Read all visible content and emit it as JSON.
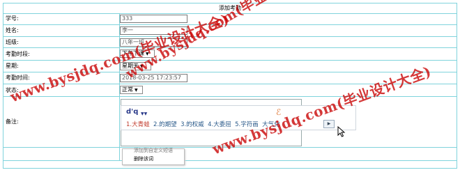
{
  "form": {
    "title": "添加考勤",
    "fields": {
      "student_id": {
        "label": "学号:",
        "value": "333"
      },
      "name": {
        "label": "姓名:",
        "value": "李一"
      },
      "class": {
        "label": "班级:",
        "value": "八年一班"
      },
      "period": {
        "label": "考勤时段:",
        "selected": "下午下课"
      },
      "weekday": {
        "label": "星期:",
        "selected": "星期天"
      },
      "time": {
        "label": "考勤时间:",
        "value": "2018-03-25 17:23:57"
      },
      "status": {
        "label": "状态:",
        "selected": "正常"
      },
      "remark": {
        "label": "备注:"
      }
    }
  },
  "ime": {
    "code": "d'q",
    "candidates": [
      "1.大青蛙",
      "2.的期望",
      "3.的权威",
      "4.大委屈",
      "5.字符画",
      "大气化"
    ],
    "nav_icon": "next-page-icon"
  },
  "context_menu": {
    "items": [
      "添加到自定义短语",
      "删除该词"
    ]
  },
  "watermarks": [
    "www.bysjdq.com(毕业设计大全)",
    "www.bysjdq.com(毕业设计大全)",
    "www.bysjdq.com(毕业设计大全)"
  ]
}
